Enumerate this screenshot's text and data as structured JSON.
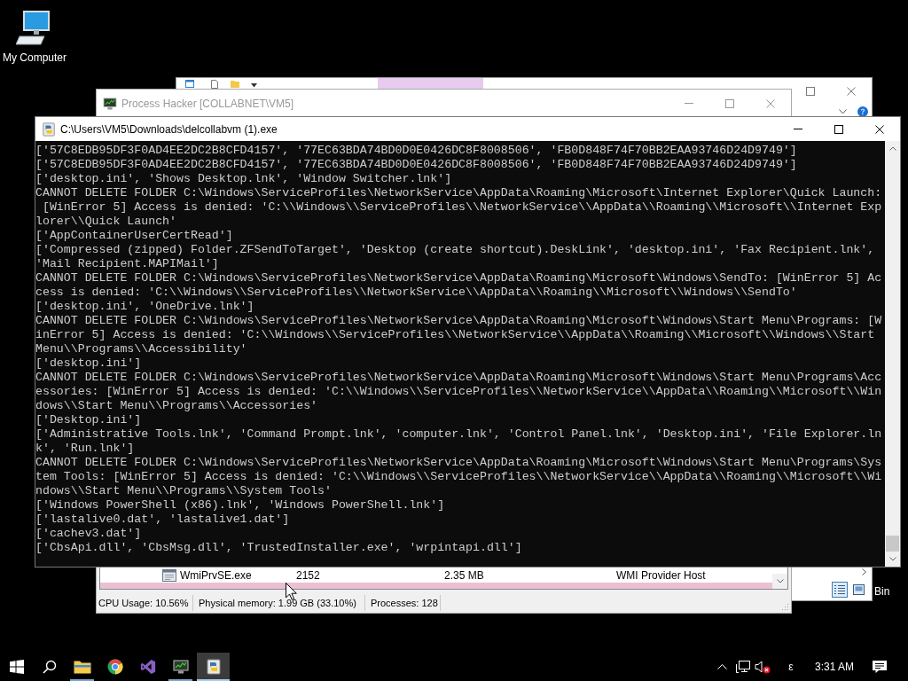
{
  "desktop": {
    "icons": [
      {
        "kind": "computer",
        "label": "My Computer"
      }
    ],
    "partial_label": "Bin"
  },
  "explorer": {
    "view_buttons": [
      {
        "kind": "details",
        "selected": true
      },
      {
        "kind": "large_icons",
        "selected": false
      }
    ]
  },
  "process_hacker": {
    "title": "Process Hacker [COLLABNET\\VM5]",
    "rows": [
      {
        "name": "WmiPrvSE.exe",
        "pid": "2152",
        "memory": "2.35 MB",
        "description": "WMI Provider Host",
        "color": "#ffffff"
      },
      {
        "color": "#ebc0d2"
      }
    ],
    "status_bar": [
      "CPU Usage: 10.56%",
      "Physical memory: 1.99 GB (33.10%)",
      "Processes: 128"
    ]
  },
  "console": {
    "title": "C:\\Users\\VM5\\Downloads\\delcollabvm (1).exe",
    "lines": [
      "['57C8EDB95DF3F0AD4EE2DC2B8CFD4157', '77EC63BDA74BD0D0E0426DC8F8008506', 'FB0D848F74F70BB2EAA93746D24D9749']",
      "['57C8EDB95DF3F0AD4EE2DC2B8CFD4157', '77EC63BDA74BD0D0E0426DC8F8008506', 'FB0D848F74F70BB2EAA93746D24D9749']",
      "['desktop.ini', 'Shows Desktop.lnk', 'Window Switcher.lnk']",
      "CANNOT DELETE FOLDER C:\\Windows\\ServiceProfiles\\NetworkService\\AppData\\Roaming\\Microsoft\\Internet Explorer\\Quick Launch:",
      " [WinError 5] Access is denied: 'C:\\\\Windows\\\\ServiceProfiles\\\\NetworkService\\\\AppData\\\\Roaming\\\\Microsoft\\\\Internet Exp",
      "lorer\\\\Quick Launch'",
      "['AppContainerUserCertRead']",
      "['Compressed (zipped) Folder.ZFSendToTarget', 'Desktop (create shortcut).DeskLink', 'desktop.ini', 'Fax Recipient.lnk',",
      "'Mail Recipient.MAPIMail']",
      "CANNOT DELETE FOLDER C:\\Windows\\ServiceProfiles\\NetworkService\\AppData\\Roaming\\Microsoft\\Windows\\SendTo: [WinError 5] Ac",
      "cess is denied: 'C:\\\\Windows\\\\ServiceProfiles\\\\NetworkService\\\\AppData\\\\Roaming\\\\Microsoft\\\\Windows\\\\SendTo'",
      "['desktop.ini', 'OneDrive.lnk']",
      "CANNOT DELETE FOLDER C:\\Windows\\ServiceProfiles\\NetworkService\\AppData\\Roaming\\Microsoft\\Windows\\Start Menu\\Programs: [W",
      "inError 5] Access is denied: 'C:\\\\Windows\\\\ServiceProfiles\\\\NetworkService\\\\AppData\\\\Roaming\\\\Microsoft\\\\Windows\\\\Start",
      "Menu\\\\Programs\\\\Accessibility'",
      "['desktop.ini']",
      "CANNOT DELETE FOLDER C:\\Windows\\ServiceProfiles\\NetworkService\\AppData\\Roaming\\Microsoft\\Windows\\Start Menu\\Programs\\Acc",
      "essories: [WinError 5] Access is denied: 'C:\\\\Windows\\\\ServiceProfiles\\\\NetworkService\\\\AppData\\\\Roaming\\\\Microsoft\\\\Win",
      "dows\\\\Start Menu\\\\Programs\\\\Accessories'",
      "['Desktop.ini']",
      "['Administrative Tools.lnk', 'Command Prompt.lnk', 'computer.lnk', 'Control Panel.lnk', 'Desktop.ini', 'File Explorer.ln",
      "k', 'Run.lnk']",
      "CANNOT DELETE FOLDER C:\\Windows\\ServiceProfiles\\NetworkService\\AppData\\Roaming\\Microsoft\\Windows\\Start Menu\\Programs\\Sys",
      "tem Tools: [WinError 5] Access is denied: 'C:\\\\Windows\\\\ServiceProfiles\\\\NetworkService\\\\AppData\\\\Roaming\\\\Microsoft\\\\Wi",
      "ndows\\\\Start Menu\\\\Programs\\\\System Tools'",
      "['Windows PowerShell (x86).lnk', 'Windows PowerShell.lnk']",
      "['lastalive0.dat', 'lastalive1.dat']",
      "['cachev3.dat']",
      "['CbsApi.dll', 'CbsMsg.dll', 'TrustedInstaller.exe', 'wrpintapi.dll']"
    ]
  },
  "taskbar": {
    "apps": [
      {
        "kind": "explorer",
        "running": true,
        "selected": false
      },
      {
        "kind": "browser",
        "running": false,
        "selected": false
      },
      {
        "kind": "editor",
        "running": false,
        "selected": false
      },
      {
        "kind": "monitor",
        "running": true,
        "selected": false
      },
      {
        "kind": "console",
        "running": true,
        "selected": true
      }
    ],
    "tray": {
      "volume_muted": true,
      "input_indicator": "ε",
      "time": "3:31 AM"
    }
  }
}
